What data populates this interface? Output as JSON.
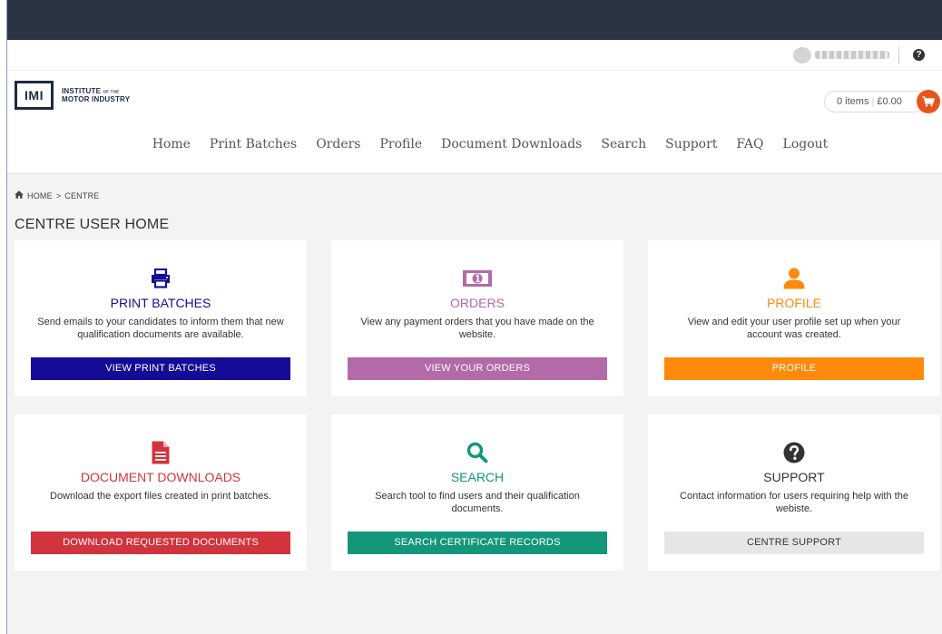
{
  "header": {
    "logo_mark": "IMI",
    "logo_line1": "INSTITUTE",
    "logo_line1_small": "OF THE",
    "logo_line2": "MOTOR INDUSTRY",
    "help_glyph": "?"
  },
  "cart": {
    "items_text": "0 items",
    "separator": "|",
    "total": "£0.00"
  },
  "nav": {
    "items": [
      "Home",
      "Print Batches",
      "Orders",
      "Profile",
      "Document Downloads",
      "Search",
      "Support",
      "FAQ",
      "Logout"
    ]
  },
  "breadcrumb": {
    "home": "HOME",
    "separator": ">",
    "current": "CENTRE"
  },
  "page": {
    "title": "CENTRE USER HOME"
  },
  "cards": [
    {
      "title": "PRINT BATCHES",
      "description": "Send emails to your candidates to inform them that new qualification documents are available.",
      "button": "VIEW PRINT BATCHES",
      "color": "#140c96",
      "icon": "printer-icon"
    },
    {
      "title": "ORDERS",
      "description": "View any payment orders that you have made on the website.",
      "button": "VIEW YOUR ORDERS",
      "color": "#b36aa8",
      "icon": "money-icon"
    },
    {
      "title": "PROFILE",
      "description": "View and edit your user profile set up when your account was created.",
      "button": "PROFILE",
      "color": "#fd8a0b",
      "icon": "user-icon"
    },
    {
      "title": "DOCUMENT DOWNLOADS",
      "description": "Download the export files created in print batches.",
      "button": "DOWNLOAD REQUESTED DOCUMENTS",
      "color": "#d2343d",
      "icon": "document-icon"
    },
    {
      "title": "SEARCH",
      "description": "Search tool to find users and their qualification documents.",
      "button": "SEARCH CERTIFICATE RECORDS",
      "color": "#14967a",
      "icon": "search-icon"
    },
    {
      "title": "SUPPORT",
      "description": "Contact information for users requiring help with the webiste.",
      "button": "CENTRE SUPPORT",
      "color": "#333333",
      "button_color": "#e6e6e6",
      "button_text_color": "#333333",
      "icon": "help-icon"
    }
  ],
  "colors": {
    "topbar": "#2a3541",
    "content_bg": "#f3f3f3",
    "cart_accent": "#e8541e",
    "logo": "#1e2a44"
  }
}
